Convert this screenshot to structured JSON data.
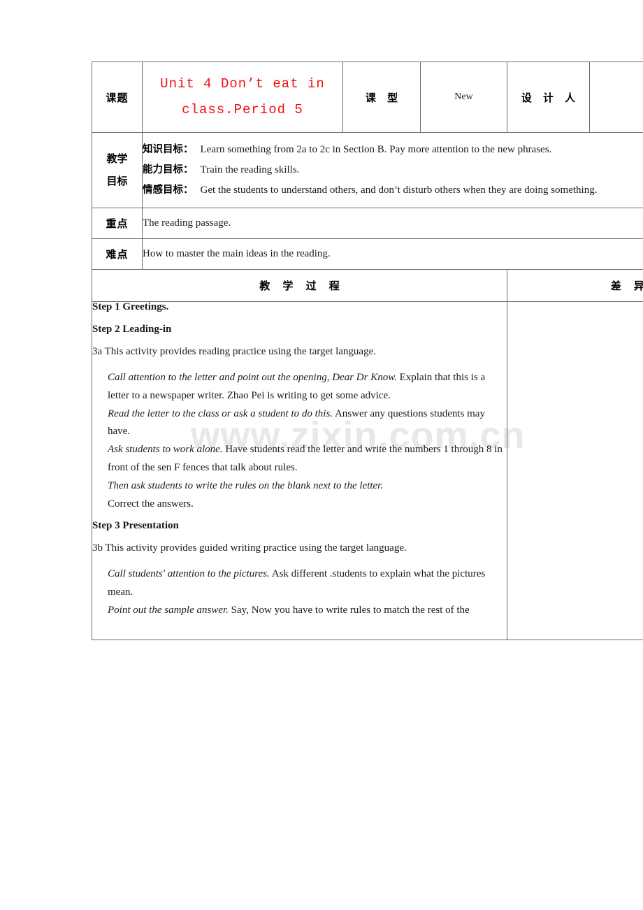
{
  "document": {
    "type": "lesson-plan-table",
    "watermark": "www.zixin.com.cn"
  },
  "table": {
    "topic_row": {
      "label": "课题",
      "title_line1": "Unit 4 Don’t eat in",
      "title_line2": "class.Period 5",
      "lesson_type_label": "课 型",
      "lesson_type_value": "New",
      "designer_label": "设 计 人",
      "designer_value": ""
    },
    "aims_row": {
      "label_line1": "教学",
      "label_line2": "目标",
      "aims": [
        {
          "key": "知识目标：",
          "value": "Learn something from 2a to 2c in Section B. Pay more attention to the new phrases."
        },
        {
          "key": "能力目标：",
          "value": "Train the reading skills."
        },
        {
          "key": "情感目标：",
          "value": "Get the students to understand others, and don’t disturb others when they are doing something."
        }
      ]
    },
    "key_point_row": {
      "label": "重点",
      "value": "The reading passage."
    },
    "difficulty_row": {
      "label": "难点",
      "value": "How to master the main ideas in the reading."
    },
    "process_header": {
      "left": "教 学 过 程",
      "right": "差 异 个 性"
    },
    "process_body": {
      "blocks": [
        {
          "style": "step",
          "text": "Step 1 Greetings."
        },
        {
          "style": "step",
          "text": "Step 2 Leading-in"
        },
        {
          "style": "plain",
          "text": "3a This activity provides reading practice using the target language."
        },
        {
          "style": "mixed",
          "italic": "Call attention to the letter and point out the opening, Dear Dr Know.",
          "rest": " Explain that this is a letter to a newspaper writer. Zhao Pei is writing to get some advice."
        },
        {
          "style": "mixed",
          "italic": "Read the letter to the class or ask a student to do this.",
          "rest": " Answer any questions students may have."
        },
        {
          "style": "mixed",
          "italic": "Ask students to work alone.",
          "rest": " Have students read the letter and write the numbers 1 through 8 in front of the sen F fences that talk about rules."
        },
        {
          "style": "italic",
          "text": "Then ask students to write the rules on the blank next to the letter."
        },
        {
          "style": "indent",
          "text": "Correct the answers."
        },
        {
          "style": "step",
          "text": "Step 3 Presentation"
        },
        {
          "style": "plain",
          "text": "3b This activity provides guided writing practice using the target language."
        },
        {
          "style": "mixed",
          "italic": "Call students' attention to the pictures.",
          "rest": " Ask different .students to explain what the pictures mean."
        },
        {
          "style": "mixed",
          "italic": "Point out the sample answer.",
          "rest": " Say, Now you have to write rules to match the rest of the"
        }
      ],
      "step1": "Step 1 Greetings.",
      "step2": "Step 2 Leading-in",
      "activity_3a": "3a This activity provides reading practice using the target language.",
      "p1_italic": "Call attention to the letter and point out the opening, Dear Dr Know.",
      "p1_rest": " Explain that this is a letter to a newspaper writer. Zhao Pei is writing to get some advice.",
      "p2_italic": "Read the letter to the class or ask a student to do this.",
      "p2_rest": " Answer any questions students may have.",
      "p3_italic": "Ask students to work alone.",
      "p3_rest": " Have students read the letter and write the numbers 1 through 8 in front of the sen F fences that talk about rules.",
      "p4_italic": "Then ask students to write the rules on the blank next to the letter.",
      "p5_plain": "Correct the answers.",
      "step3": "Step 3 Presentation",
      "activity_3b": "3b This activity provides guided writing practice using the target language.",
      "p6_italic": "Call students' attention to the pictures.",
      "p6_rest": " Ask different .students to explain what the pictures mean.",
      "p7_italic": "Point out the sample answer.",
      "p7_rest": " Say, Now you have to write rules to match the rest of the"
    },
    "differentiation_body": ""
  },
  "colors": {
    "title_red": "#ee1111",
    "border_gray": "#6b6b6b",
    "text_black": "#1a1a1a",
    "watermark_gray": "#e8e8e8"
  }
}
